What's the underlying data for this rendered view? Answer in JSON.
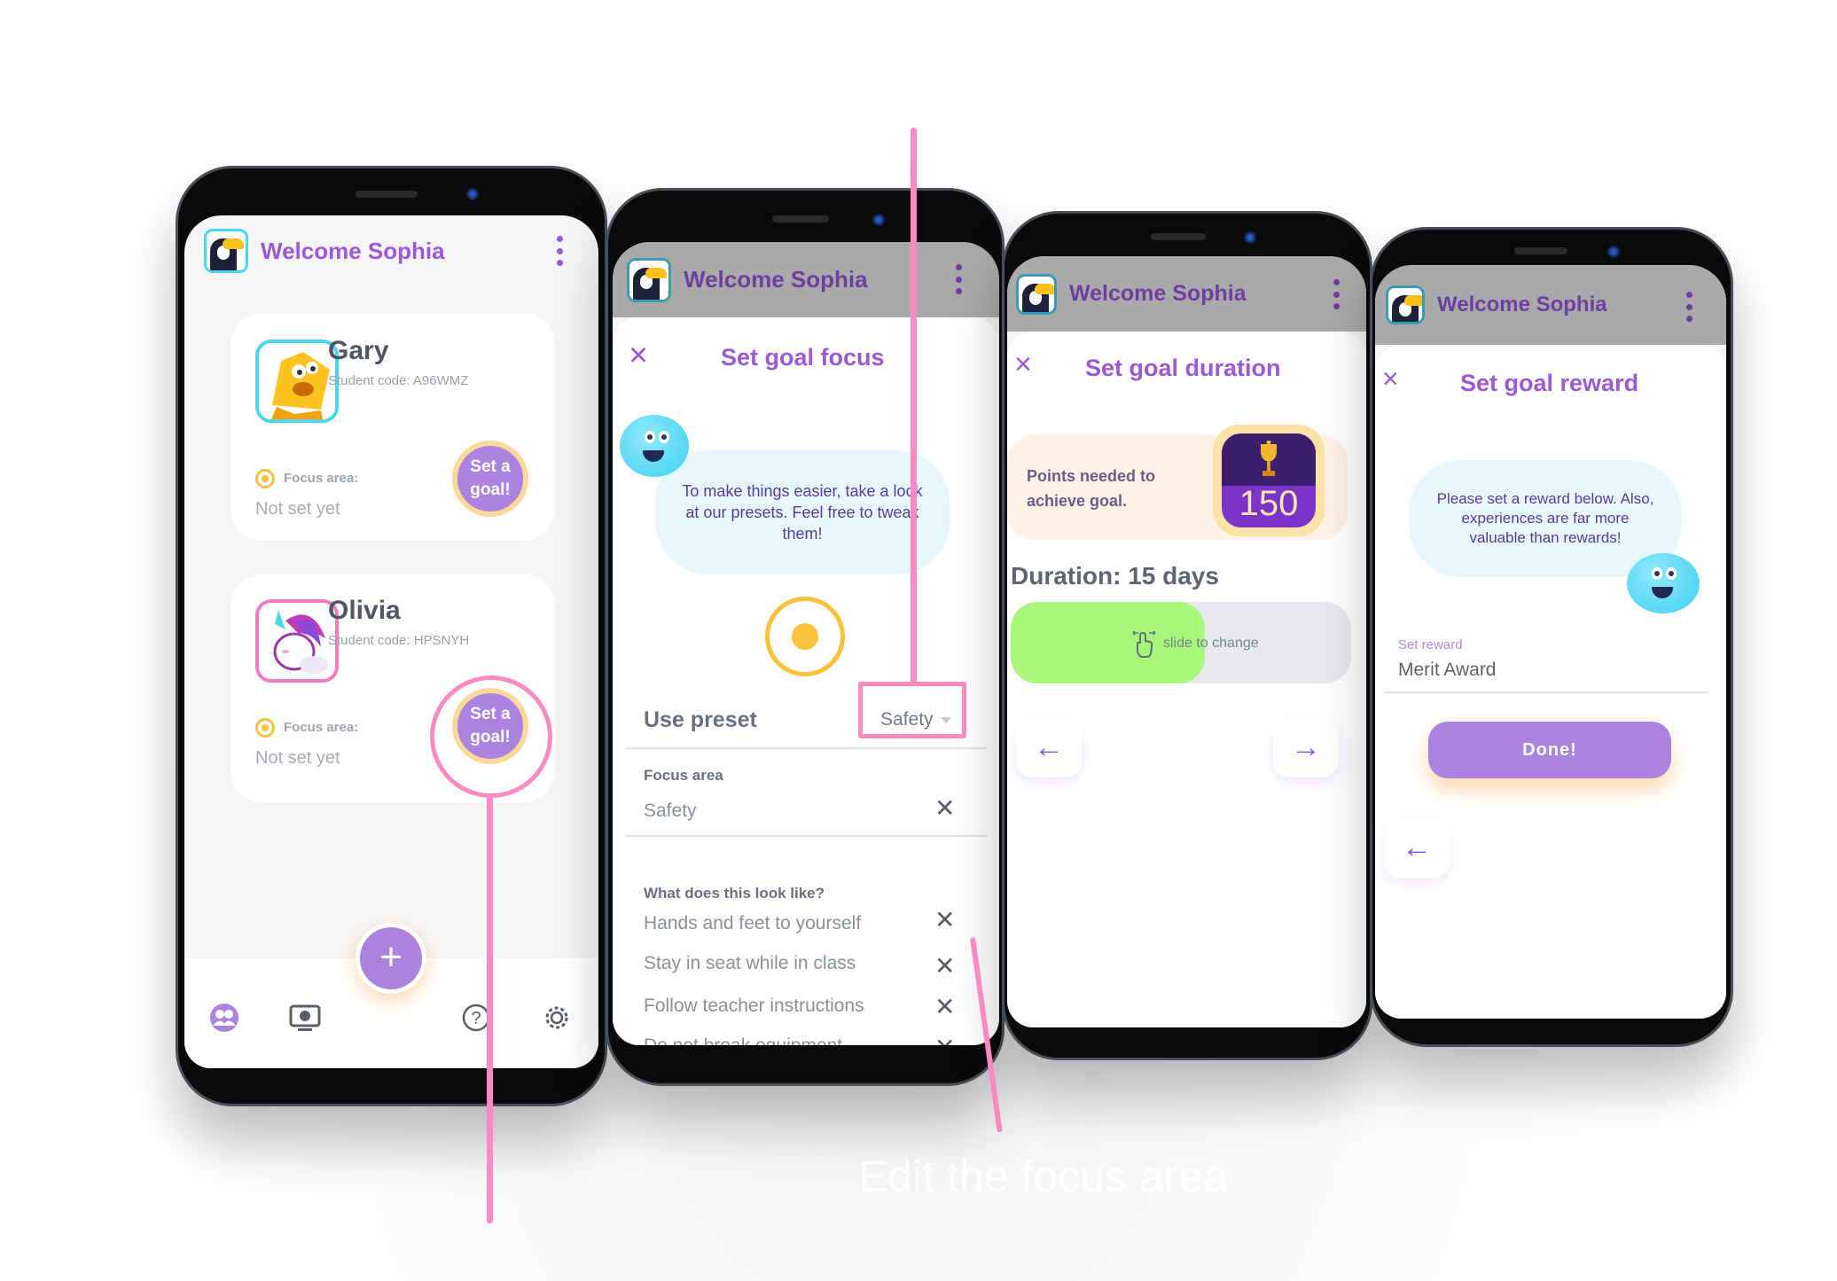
{
  "app": {
    "welcome_title": "Welcome Sophia",
    "brand_color": "#9b59d6",
    "accent_button_color": "#ab82df",
    "annotation_color": "#fb8ac3"
  },
  "home": {
    "students": [
      {
        "name": "Gary",
        "student_code": "Student code: A96WMZ",
        "focus_label": "Focus area:",
        "focus_value": "Not set yet",
        "goal_button": "Set a goal!",
        "avatar": "yellow-star-character"
      },
      {
        "name": "Olivia",
        "student_code": "Student code: HPSNYH",
        "focus_label": "Focus area:",
        "focus_value": "Not set yet",
        "goal_button": "Set a goal!",
        "avatar": "unicorn-character"
      }
    ],
    "fab_label": "+",
    "nav": [
      {
        "icon": "students-icon",
        "active": true
      },
      {
        "icon": "video-icon",
        "active": false
      },
      {
        "icon": "help-icon",
        "active": false
      },
      {
        "icon": "settings-icon",
        "active": false
      }
    ]
  },
  "goal_focus": {
    "title": "Set goal focus",
    "close": "×",
    "bubble_text": "To make things easier, take a look at our presets. Feel free to tweak them!",
    "use_preset_label": "Use preset",
    "preset_value": "Safety",
    "focus_area_label": "Focus area",
    "focus_area_value": "Safety",
    "looks_like_label": "What does this look like?",
    "behaviours": [
      "Hands and feet to yourself",
      "Stay in seat while in class",
      "Follow teacher instructions",
      "Do not break equipment"
    ],
    "remove_icon": "✕"
  },
  "goal_duration": {
    "title": "Set goal duration",
    "close": "×",
    "points_text": "Points needed to achieve goal.",
    "points_value": "150",
    "duration_text": "Duration: 15 days",
    "slider_hint": "slide to change",
    "slider_fraction": 0.57,
    "back_arrow": "←",
    "next_arrow": "→"
  },
  "goal_reward": {
    "title": "Set goal reward",
    "close": "×",
    "bubble_text": "Please set a reward below. Also, experiences are far more valuable than rewards!",
    "reward_label": "Set reward",
    "reward_value": "Merit Award",
    "done_label": "Done!",
    "back_arrow": "←"
  },
  "annotations": {
    "caption": "Edit the focus area"
  }
}
